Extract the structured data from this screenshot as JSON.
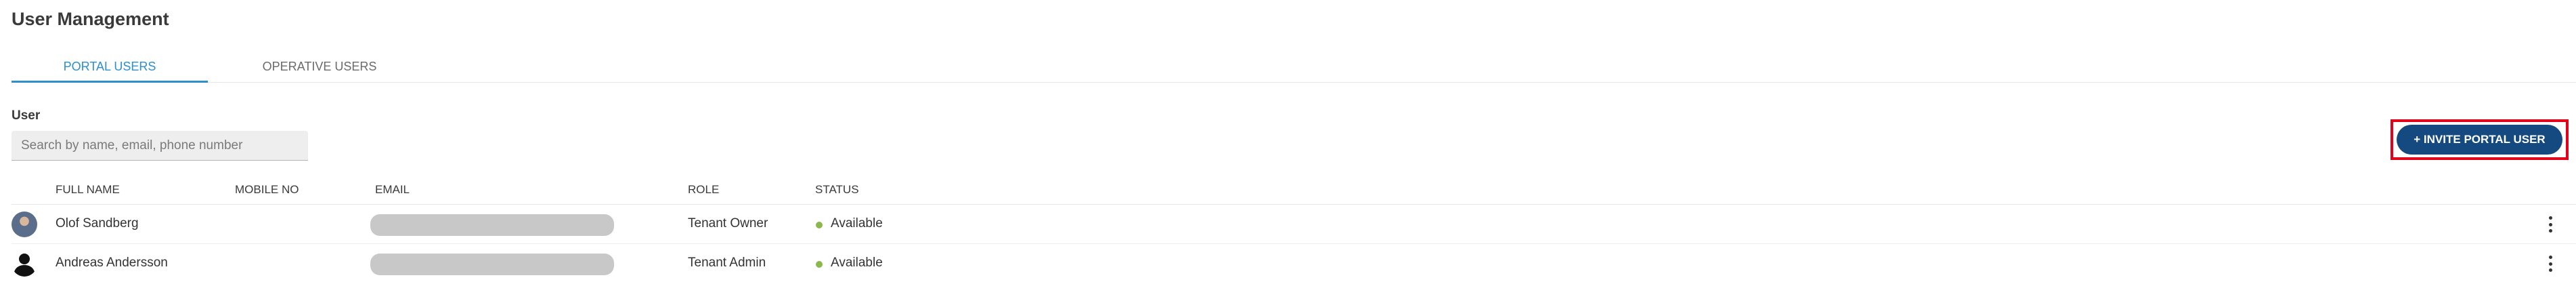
{
  "page": {
    "title": "User Management"
  },
  "tabs": [
    {
      "label": "PORTAL USERS",
      "active": true
    },
    {
      "label": "OPERATIVE USERS",
      "active": false
    }
  ],
  "filter": {
    "label": "User",
    "search_placeholder": "Search by name, email, phone number",
    "search_value": ""
  },
  "actions": {
    "invite_label": "+ INVITE PORTAL USER"
  },
  "table": {
    "columns": [
      "FULL NAME",
      "MOBILE NO",
      "EMAIL",
      "ROLE",
      "STATUS"
    ],
    "rows": [
      {
        "full_name": "Olof Sandberg",
        "mobile": "",
        "role": "Tenant Owner",
        "status": "Available",
        "avatar": "photo"
      },
      {
        "full_name": "Andreas Andersson",
        "mobile": "",
        "role": "Tenant Admin",
        "status": "Available",
        "avatar": "person-silhouette-icon"
      }
    ]
  },
  "colors": {
    "accent": "#2b8fd0",
    "primary_button": "#154a80",
    "highlight_border": "#e3001b",
    "status_available": "#8bb84a"
  }
}
